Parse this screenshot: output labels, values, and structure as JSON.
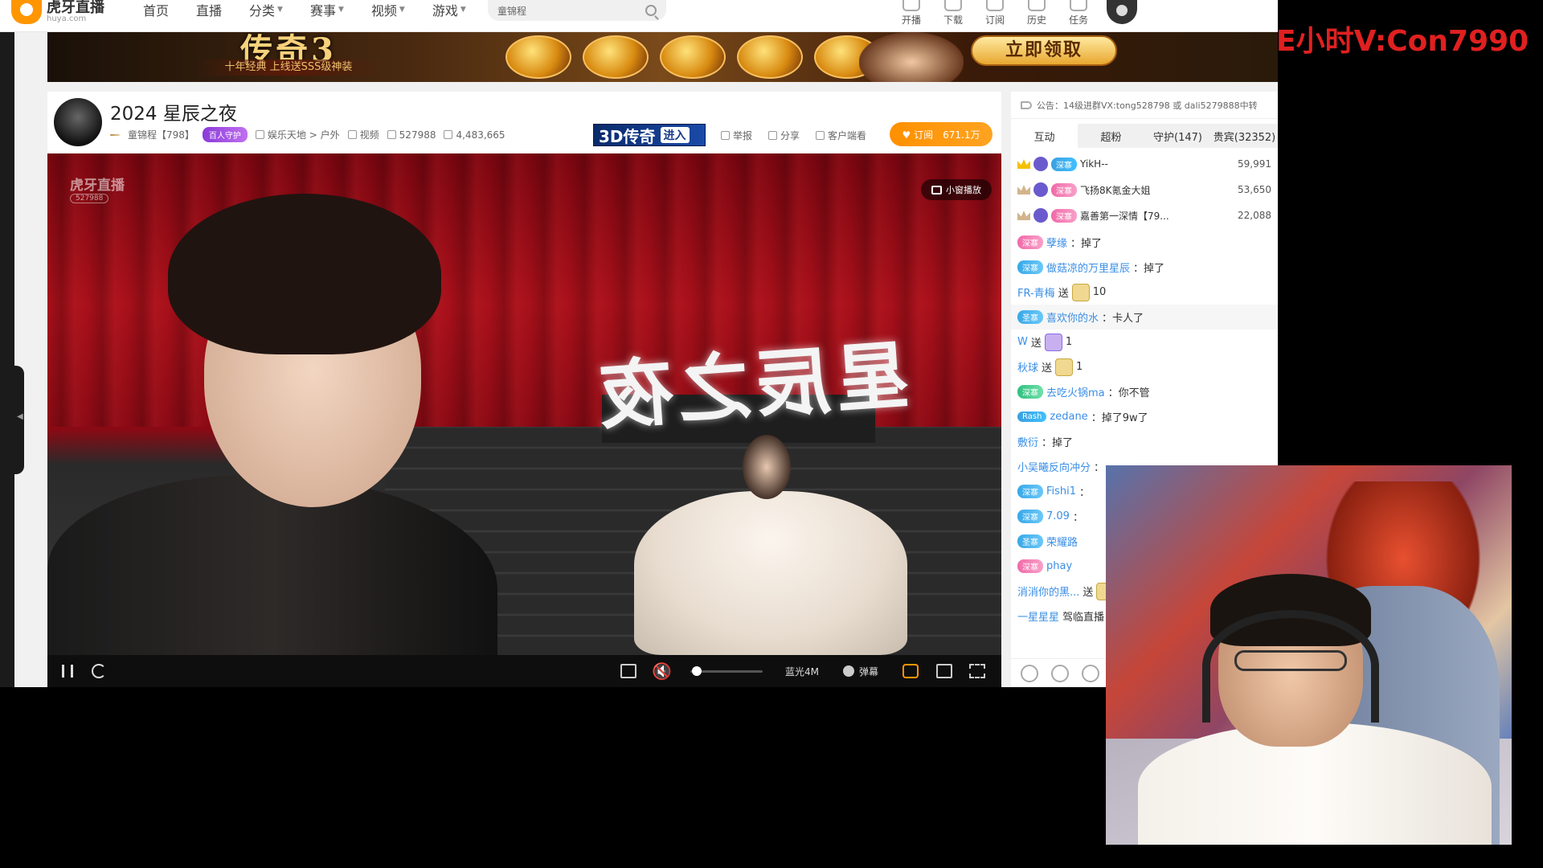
{
  "nav": {
    "logo_cn": "虎牙直播",
    "logo_en": "huya.com",
    "items": [
      {
        "label": "首页",
        "has_caret": false
      },
      {
        "label": "直播",
        "has_caret": false
      },
      {
        "label": "分类",
        "has_caret": true
      },
      {
        "label": "赛事",
        "has_caret": true
      },
      {
        "label": "视频",
        "has_caret": true
      },
      {
        "label": "游戏",
        "has_caret": true
      }
    ],
    "search_value": "童锦程",
    "right_items": [
      "开播",
      "下载",
      "订阅",
      "历史",
      "任务"
    ]
  },
  "banner": {
    "title": "传奇3",
    "subtitle": "十年经典 上线送SSS级神装",
    "cta": "立即领取"
  },
  "room": {
    "title": "2024 星辰之夜",
    "level_badge": "",
    "anchor_name": "童锦程【798】",
    "guard_badge": "百人守护",
    "category": "娱乐天地",
    "category_sep": ">",
    "subcategory": "户外",
    "video_label": "视频",
    "room_id": "527988",
    "heat": "4,483,665",
    "ad_text": "3D传奇",
    "ad_enter": "进入",
    "actions": [
      "举报",
      "分享",
      "客户端看"
    ],
    "subscribe_label": "订阅",
    "subscribe_count": "671.1万"
  },
  "video": {
    "stage_sign": "星辰之夜",
    "watermark_logo": "虎牙直播",
    "watermark_room": "527988",
    "mini_play": "小窗播放",
    "quality": "蓝光4M",
    "danmu_label": "弹幕",
    "volume": 0.0
  },
  "side": {
    "notice": "公告：14级进群VX:tong528798 或 dali5279888中转",
    "tabs": [
      "互动",
      "超粉",
      "守护(147)",
      "贵宾(32352)"
    ],
    "rank": [
      {
        "badge": "深寨",
        "badge_color": "gold",
        "name": "YikH--",
        "score": "59,991"
      },
      {
        "badge": "深寨",
        "badge_color": "pink",
        "name": "飞扬8K氪金大姐",
        "score": "53,650"
      },
      {
        "badge": "深寨",
        "badge_color": "pink",
        "name": "嘉善第一深情【79...",
        "score": "22,088"
      }
    ],
    "chat": [
      {
        "badge": "深寨",
        "badge_color": "pink",
        "user": "孽缘",
        "text": "：掉了"
      },
      {
        "badge": "深寨",
        "badge_color": "blue",
        "user": "做菇凉的万里星辰",
        "text": "：掉了"
      },
      {
        "user": "FR-青梅",
        "gift_text": "送",
        "gift_count": "10"
      },
      {
        "badge": "圣寨",
        "badge_color": "blue",
        "user": "喜欢你的水",
        "text": "：卡人了"
      },
      {
        "user": "W",
        "gift_text": "送",
        "gift_count": "1",
        "gift_purple": true
      },
      {
        "user": "秋球",
        "gift_text": "送",
        "gift_count": "1"
      },
      {
        "badge": "深寨",
        "badge_color": "green",
        "user": "去吃火锅ma",
        "text": "：你不管"
      },
      {
        "badge": "Rash",
        "badge_color": "gold",
        "user": "zedane",
        "text": "：掉了9w了"
      },
      {
        "user": "敷衍",
        "text": "：掉了"
      },
      {
        "user": "小吴曦反向冲分",
        "text": "："
      },
      {
        "badge": "深寨",
        "badge_color": "blue",
        "user": "Fishi1",
        "text": "："
      },
      {
        "badge": "深寨",
        "badge_color": "blue",
        "user": "7.09",
        "text": "："
      },
      {
        "badge": "圣寨",
        "badge_color": "blue",
        "user": "荣耀路",
        "text": ""
      },
      {
        "badge": "深寨",
        "badge_color": "pink",
        "user": "phay",
        "text": ""
      },
      {
        "user": "消消你的黑...",
        "gift_text": "送"
      },
      {
        "user": "一星星星",
        "text": "驾临直播"
      }
    ]
  },
  "overlay": {
    "contact": "E小时V:Con7990"
  }
}
